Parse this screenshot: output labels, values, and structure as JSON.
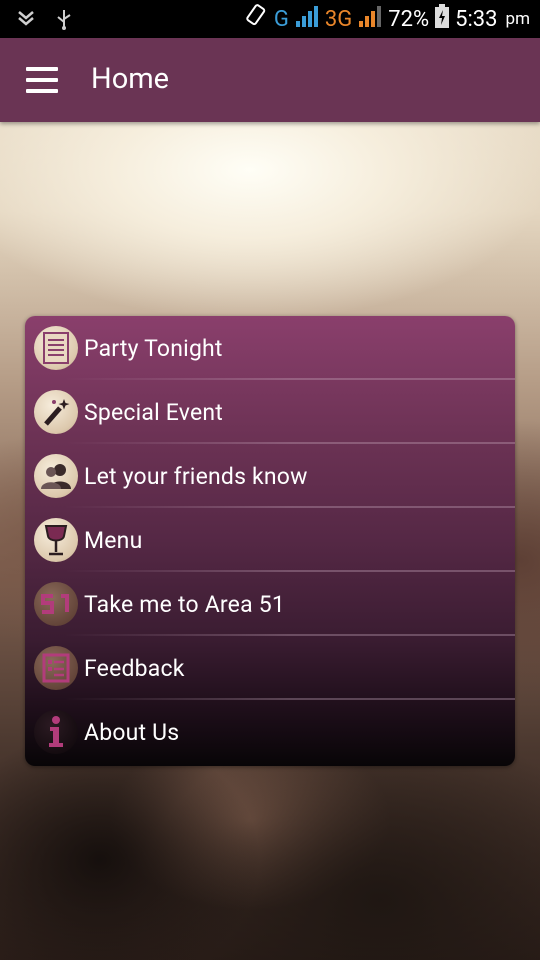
{
  "status_bar": {
    "network_g": "G",
    "network_3g": "3G",
    "battery": "72%",
    "time": "5:33",
    "ampm": "pm"
  },
  "app_bar": {
    "title": "Home"
  },
  "menu": {
    "items": [
      {
        "label": "Party Tonight",
        "icon": "document-list-icon"
      },
      {
        "label": "Special Event",
        "icon": "magic-wand-icon"
      },
      {
        "label": "Let your friends know",
        "icon": "people-icon"
      },
      {
        "label": "Menu",
        "icon": "wine-glass-icon"
      },
      {
        "label": "Take me to Area 51",
        "icon": "area51-logo-icon"
      },
      {
        "label": "Feedback",
        "icon": "feedback-form-icon"
      },
      {
        "label": "About Us",
        "icon": "info-icon"
      }
    ]
  },
  "colors": {
    "app_bar": "#6a3454",
    "menu_top": "#8a3f6c",
    "menu_bottom": "#080507",
    "icon_accent": "#9a3a6f"
  }
}
